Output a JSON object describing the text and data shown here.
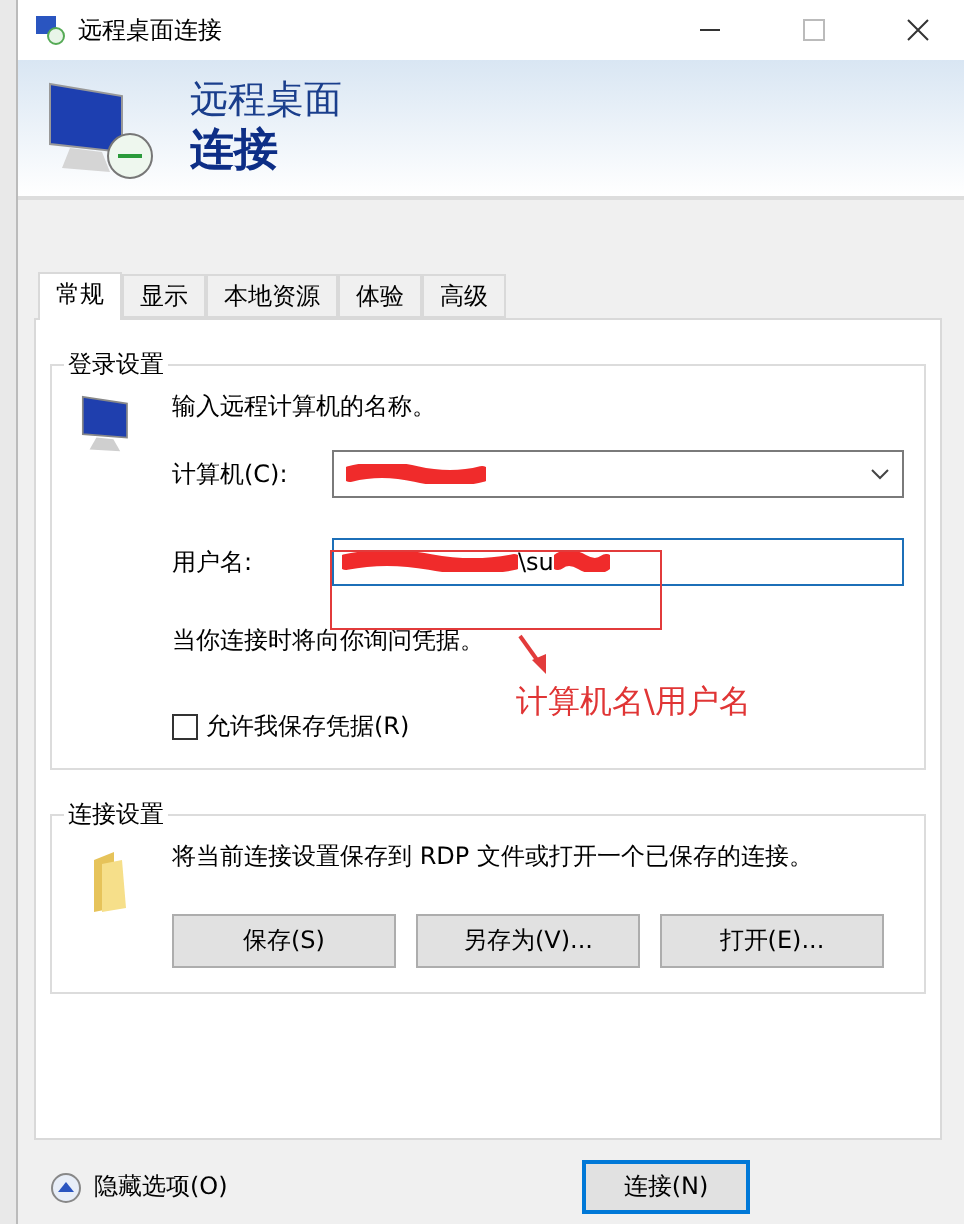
{
  "window": {
    "title": "远程桌面连接"
  },
  "banner": {
    "line_1": "远程桌面",
    "line_2": "连接"
  },
  "tabs": [
    {
      "label": "常规",
      "selected": true
    },
    {
      "label": "显示",
      "selected": false
    },
    {
      "label": "本地资源",
      "selected": false
    },
    {
      "label": "体验",
      "selected": false
    },
    {
      "label": "高级",
      "selected": false
    }
  ],
  "login_settings": {
    "title": "登录设置",
    "intro": "输入远程计算机的名称。",
    "computer": {
      "label": "计算机(C):",
      "redacted": true
    },
    "username": {
      "label": "用户名:",
      "value": "\\su",
      "redacted": true
    },
    "note": "当你连接时将向你询问凭据。",
    "save_credentials": {
      "label": "允许我保存凭据(R)",
      "checked": false
    }
  },
  "annotation": {
    "text": "计算机名\\用户名"
  },
  "connection_settings": {
    "title": "连接设置",
    "description": "将当前连接设置保存到 RDP 文件或打开一个已保存的连接。",
    "buttons": [
      "保存(S)",
      "另存为(V)...",
      "打开(E)..."
    ]
  },
  "footer": {
    "toggle": "隐藏选项(O)",
    "connect": "连接(N)"
  }
}
